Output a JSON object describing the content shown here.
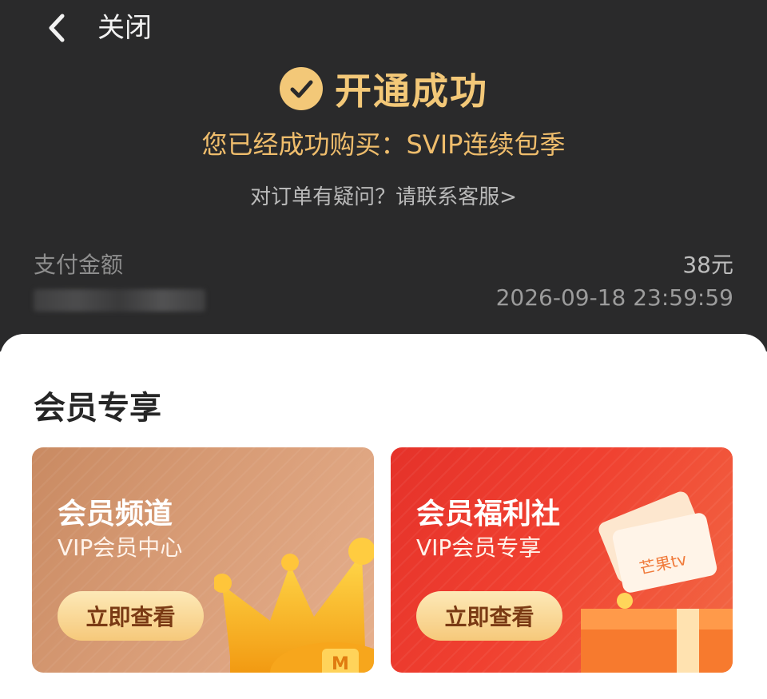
{
  "nav": {
    "close_label": "关闭",
    "back_icon": "chevron-left-icon"
  },
  "status": {
    "check_icon": "check-circle-icon",
    "title": "开通成功",
    "purchase_text": "您已经成功购买：SVIP连续包季",
    "question_link": "对订单有疑问？请联系客服>"
  },
  "payment": {
    "amount_label": "支付金额",
    "amount_value": "38元",
    "time_value": "2026-09-18 23:59:59"
  },
  "section": {
    "title": "会员专享"
  },
  "cards": [
    {
      "title": "会员频道",
      "subtitle": "VIP会员中心",
      "button": "立即查看",
      "icon": "crown-icon"
    },
    {
      "title": "会员福利社",
      "subtitle": "VIP会员专享",
      "button": "立即查看",
      "icon": "gift-box-icon",
      "badge": "芒果tv"
    }
  ],
  "colors": {
    "header_bg": "#2a2a2b",
    "gold": "#f3c878",
    "card1_bg": "#d89c76",
    "card2_bg": "#f04030",
    "button_bg": "#f6c97b"
  }
}
